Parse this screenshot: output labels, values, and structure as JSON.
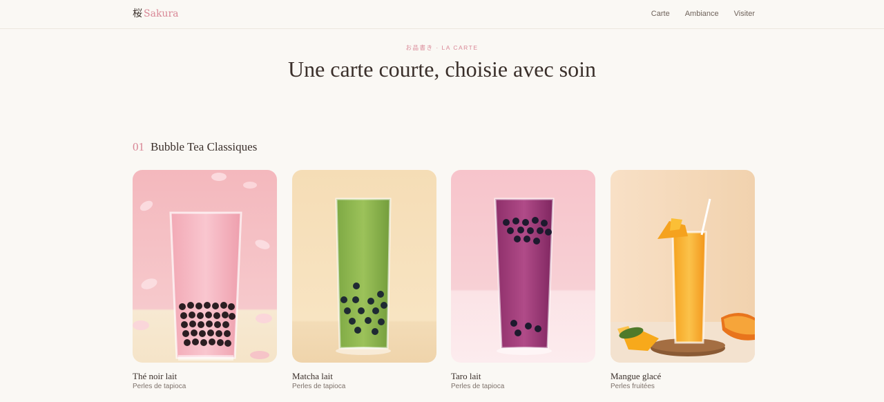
{
  "nav": {
    "logo_kanji": "桜",
    "logo_text": "Sakura",
    "links": [
      {
        "label": "Carte"
      },
      {
        "label": "Ambiance"
      },
      {
        "label": "Visiter"
      }
    ]
  },
  "hero": {
    "eyebrow": "お品書き · LA CARTE",
    "title": "Une carte courte, choisie avec soin"
  },
  "section": {
    "number": "01",
    "title": "Bubble Tea Classiques"
  },
  "menu": [
    {
      "name": "Thé noir lait",
      "description": "Perles de tapioca",
      "image": "pink-milk-tea-photo"
    },
    {
      "name": "Matcha lait",
      "description": "Perles de tapioca",
      "image": "matcha-tea-photo"
    },
    {
      "name": "Taro lait",
      "description": "Perles de tapioca",
      "image": "taro-tea-photo"
    },
    {
      "name": "Mangue glacé",
      "description": "Perles fruitées",
      "image": "mango-tea-photo"
    }
  ],
  "colors": {
    "accent": "#d98796",
    "background": "#faf8f4",
    "text": "#3a2f2a"
  }
}
